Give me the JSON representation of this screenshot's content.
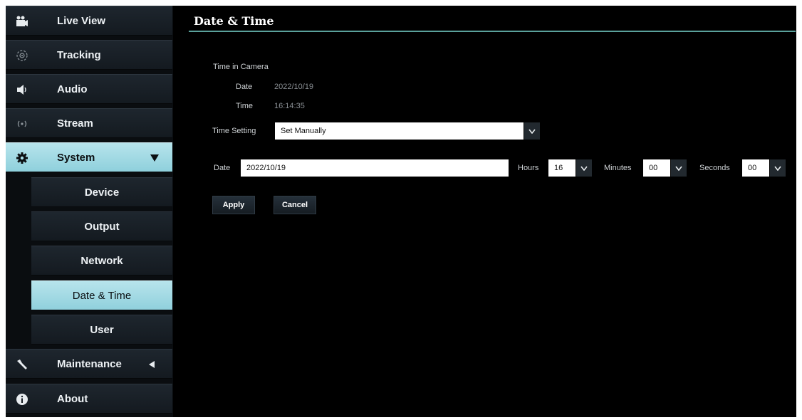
{
  "sidebar": {
    "items": [
      {
        "label": "Live View",
        "icon": "camera-icon"
      },
      {
        "label": "Tracking",
        "icon": "tracking-icon"
      },
      {
        "label": "Audio",
        "icon": "speaker-icon"
      },
      {
        "label": "Stream",
        "icon": "stream-icon"
      },
      {
        "label": "System",
        "icon": "gear-icon",
        "arrow": "down"
      },
      {
        "label": "Maintenance",
        "icon": "wrench-icon",
        "arrow": "left"
      },
      {
        "label": "About",
        "icon": "info-icon"
      }
    ],
    "system_subitems": [
      {
        "label": "Device"
      },
      {
        "label": "Output"
      },
      {
        "label": "Network"
      },
      {
        "label": "Date & Time"
      },
      {
        "label": "User"
      }
    ]
  },
  "main": {
    "title": "Date & Time",
    "time_in_camera": {
      "heading": "Time in Camera",
      "date_label": "Date",
      "date_value": "2022/10/19",
      "time_label": "Time",
      "time_value": "16:14:35"
    },
    "time_setting": {
      "label": "Time Setting",
      "selected": "Set Manually"
    },
    "manual": {
      "date_label": "Date",
      "date_value": "2022/10/19",
      "hours_label": "Hours",
      "hours_value": "16",
      "minutes_label": "Minutes",
      "minutes_value": "00",
      "seconds_label": "Seconds",
      "seconds_value": "00"
    },
    "buttons": {
      "apply": "Apply",
      "cancel": "Cancel"
    }
  },
  "colors": {
    "accent": "#9fd9e3",
    "title_rule": "#5aa19b",
    "background": "#000000",
    "nav_bg": "#1a2128"
  }
}
